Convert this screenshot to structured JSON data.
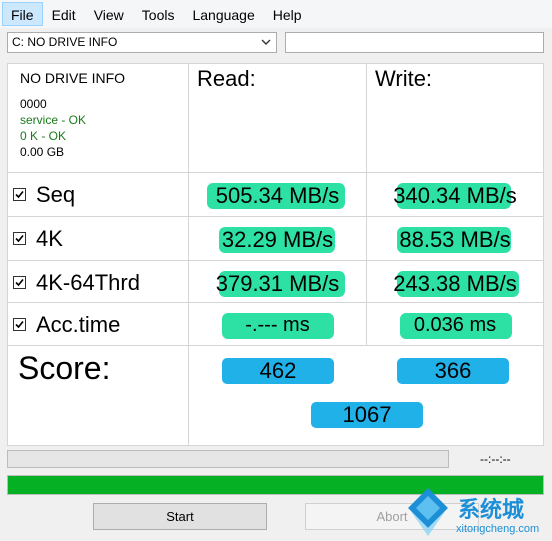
{
  "menu": [
    "File",
    "Edit",
    "View",
    "Tools",
    "Language",
    "Help"
  ],
  "drive": {
    "selected": "C: NO DRIVE INFO",
    "name_value": ""
  },
  "info": {
    "name": "NO DRIVE INFO",
    "firmware": "0000",
    "service": "service - OK",
    "alignment": "0 K - OK",
    "size": "0.00 GB"
  },
  "headers": {
    "read": "Read:",
    "write": "Write:"
  },
  "rows": [
    {
      "label": "Seq",
      "checked": true,
      "read": "505.34 MB/s",
      "write": "340.34 MB/s"
    },
    {
      "label": "4K",
      "checked": true,
      "read": "32.29 MB/s",
      "write": "88.53 MB/s"
    },
    {
      "label": "4K-64Thrd",
      "checked": true,
      "read": "379.31 MB/s",
      "write": "243.38 MB/s"
    },
    {
      "label": "Acc.time",
      "checked": true,
      "read": "-.--- ms",
      "write": "0.036 ms"
    }
  ],
  "score": {
    "label": "Score:",
    "read": "462",
    "write": "366",
    "total": "1067"
  },
  "status": {
    "elapsed": "--:--:--",
    "progress_percent": 100
  },
  "buttons": {
    "start": "Start",
    "abort": "Abort"
  },
  "watermark": {
    "text": "系统城",
    "url": "xitongcheng.com"
  },
  "colors": {
    "result_bar": "#2de0a4",
    "score_bar": "#1fb1e8",
    "progress": "#06b025",
    "ok_text": "#1a7a1a"
  }
}
